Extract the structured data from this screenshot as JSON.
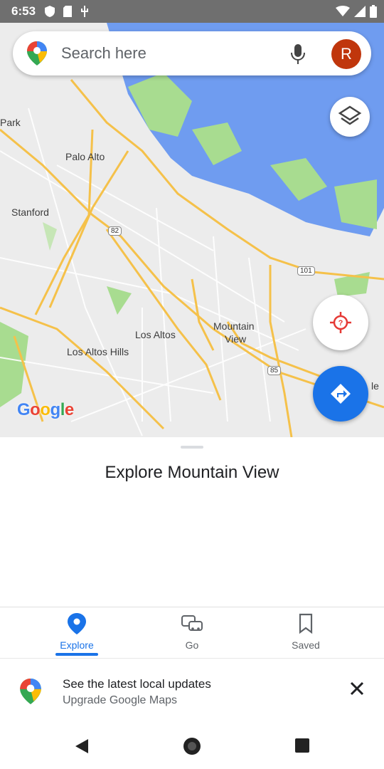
{
  "status_bar": {
    "time": "6:53"
  },
  "search": {
    "placeholder": "Search here",
    "avatar_initial": "R"
  },
  "map": {
    "labels": {
      "park": "Park",
      "palo_alto": "Palo Alto",
      "stanford": "Stanford",
      "los_altos": "Los Altos",
      "los_altos_hills": "Los Altos Hills",
      "mountain_view_1": "Mountain",
      "mountain_view_2": "View",
      "right_edge": "le"
    },
    "shields": {
      "r82": "82",
      "r101": "101",
      "r85": "85"
    },
    "logo": "Google"
  },
  "sheet": {
    "title": "Explore Mountain View"
  },
  "bottom_nav": {
    "explore": "Explore",
    "go": "Go",
    "saved": "Saved"
  },
  "banner": {
    "title": "See the latest local updates",
    "subtitle": "Upgrade Google Maps"
  },
  "colors": {
    "accent": "#1a73e8",
    "avatar": "#c0360c",
    "water": "#6f9cf0",
    "park": "#a8dc90",
    "road": "#f5c14a"
  }
}
